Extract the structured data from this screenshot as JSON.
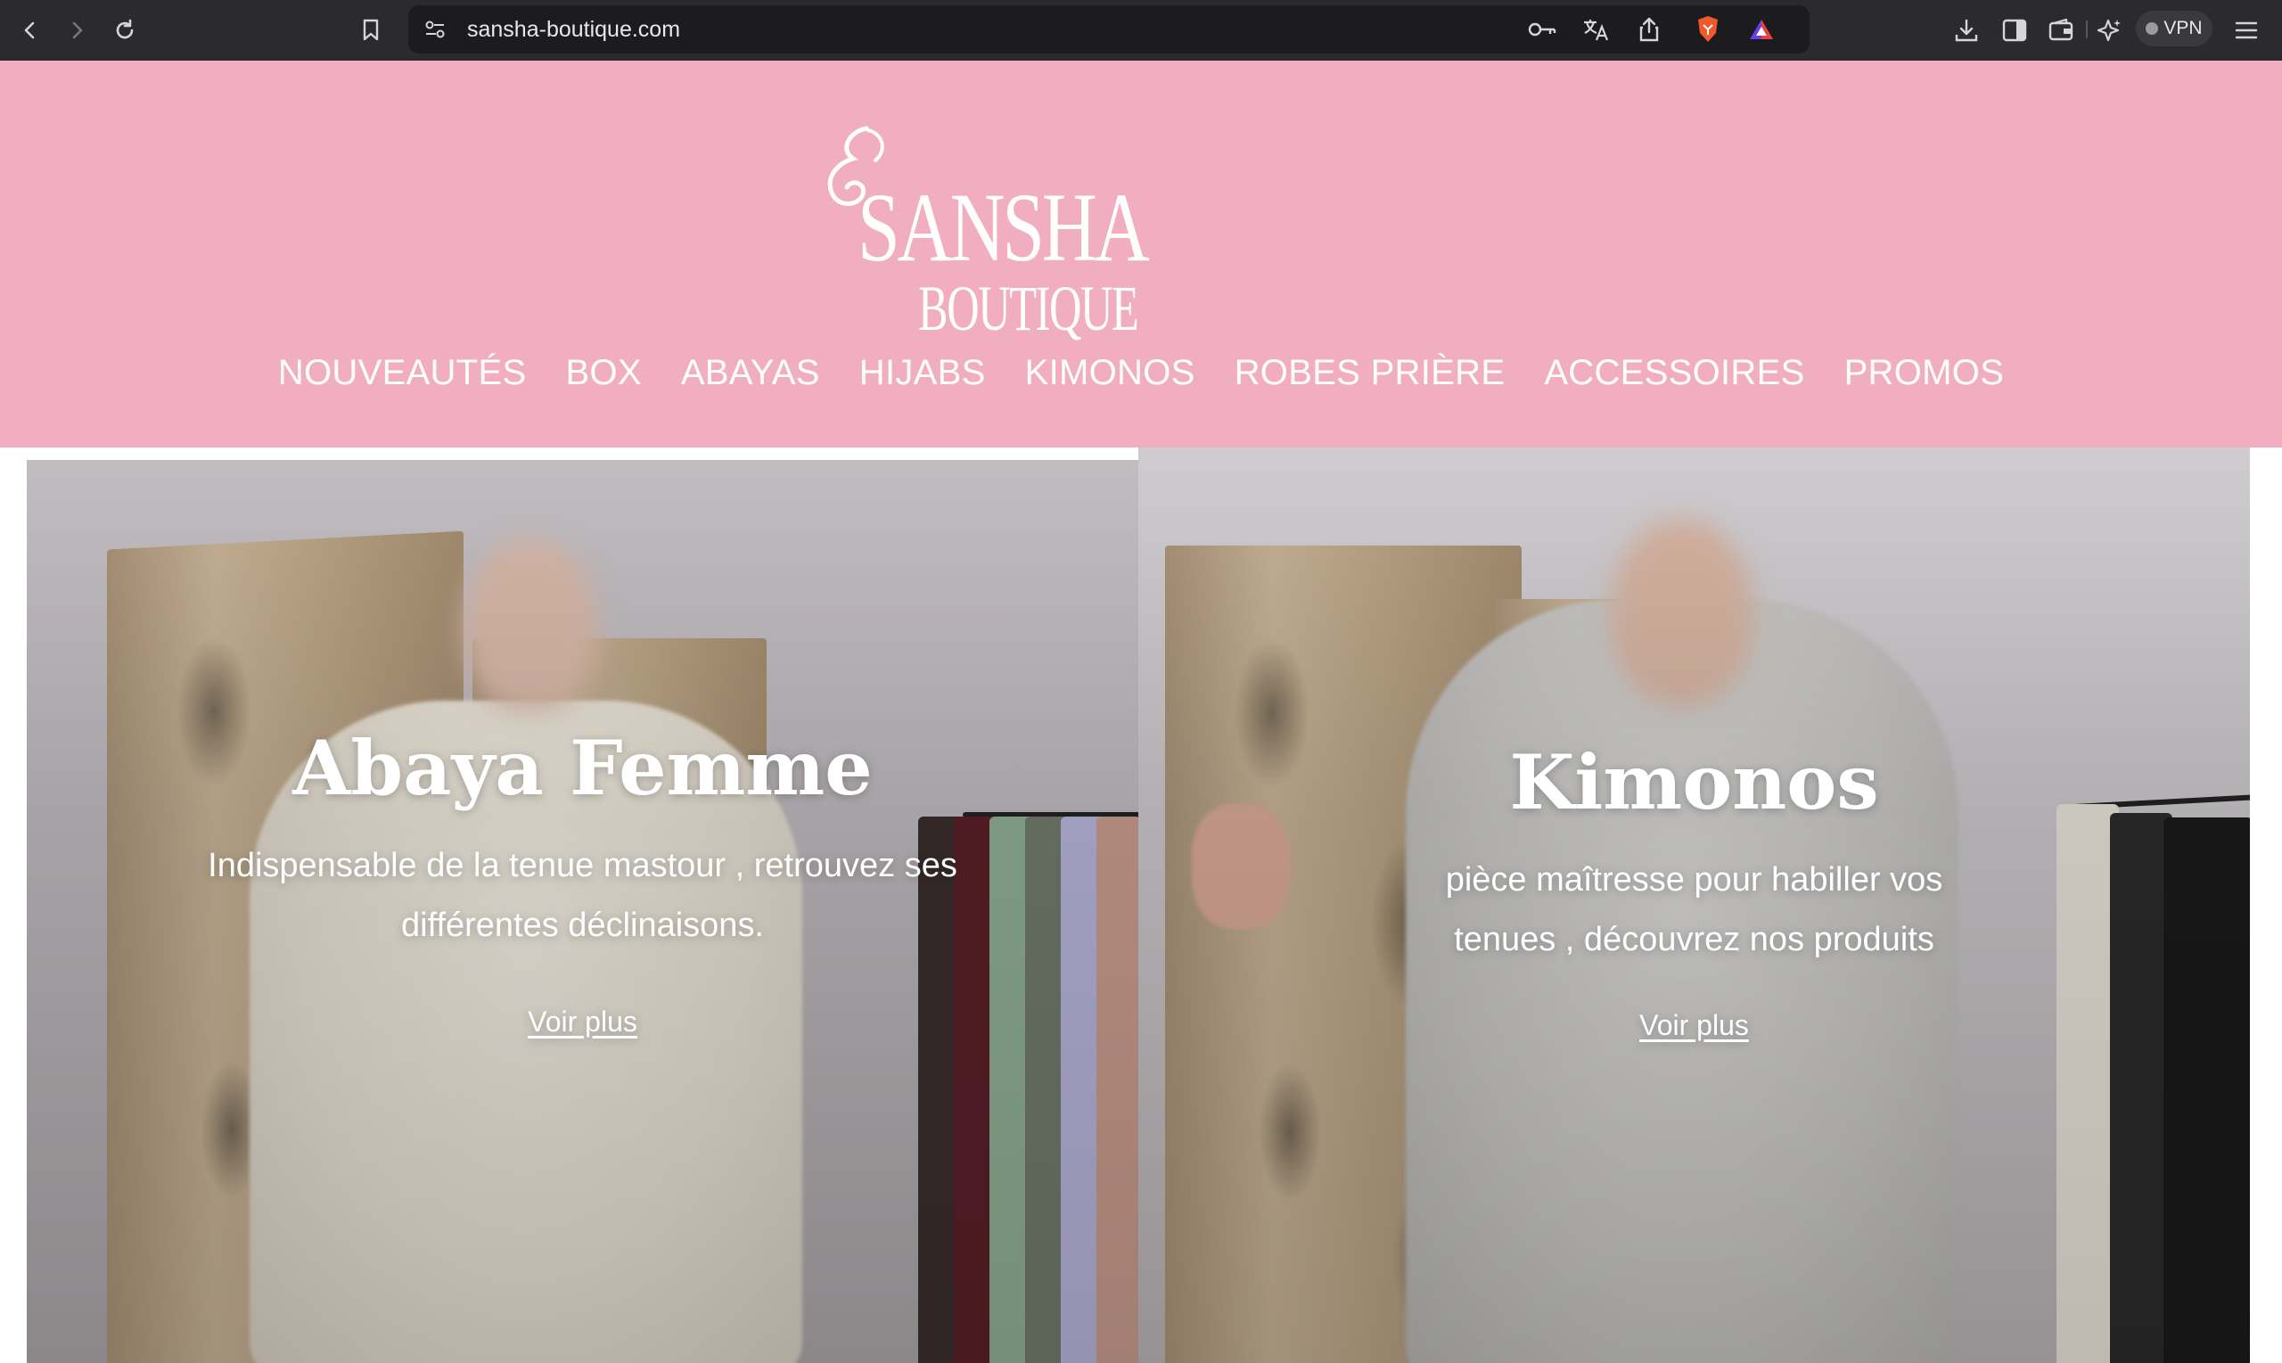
{
  "browser": {
    "url": "sansha-boutique.com",
    "vpn_label": "VPN",
    "icons": [
      "back-icon",
      "forward-icon",
      "reload-icon",
      "bookmark-icon",
      "site-settings-icon",
      "password-key-icon",
      "translate-icon",
      "share-icon",
      "brave-shields-icon",
      "rewards-icon",
      "downloads-icon",
      "sidebar-icon",
      "wallet-icon",
      "leo-ai-icon",
      "menu-icon"
    ]
  },
  "site": {
    "logo": {
      "main": "SANSHA",
      "sub": "BOUTIQUE"
    },
    "nav": [
      "NOUVEAUTÉS",
      "BOX",
      "ABAYAS",
      "HIJABS",
      "KIMONOS",
      "ROBES PRIÈRE",
      "ACCESSOIRES",
      "PROMOS"
    ],
    "colors": {
      "header_bg": "#f1aec0",
      "chrome_bg": "#2b2b2d"
    }
  },
  "hero": [
    {
      "title": "Abaya Femme",
      "text": "Indispensable de la tenue mastour , retrouvez ses différentes déclinaisons.",
      "link": "Voir plus"
    },
    {
      "title": "Kimonos",
      "text": "pièce maîtresse pour habiller vos tenues , découvrez nos produits",
      "link": "Voir plus"
    }
  ]
}
